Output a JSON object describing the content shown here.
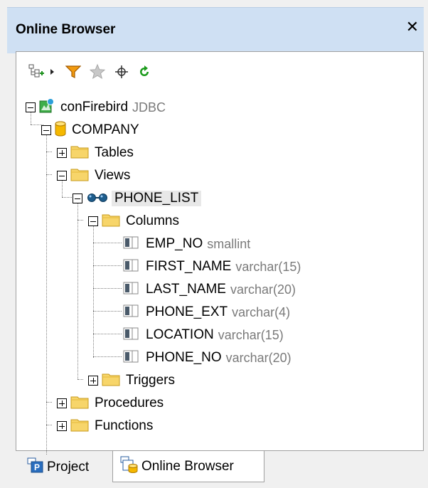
{
  "window": {
    "title": "Online Browser"
  },
  "toolbar": {
    "buttons": [
      {
        "icon": "add-connection-icon"
      },
      {
        "icon": "dropdown-arrow-icon"
      },
      {
        "icon": "filter-icon"
      },
      {
        "icon": "favorites-star-icon"
      },
      {
        "icon": "locate-crosshair-icon"
      },
      {
        "icon": "refresh-icon"
      }
    ]
  },
  "tree": {
    "connection": {
      "label": "conFirebird",
      "type": "JDBC"
    },
    "database": {
      "label": "COMPANY"
    },
    "tables": {
      "label": "Tables"
    },
    "views": {
      "label": "Views"
    },
    "view": {
      "label": "PHONE_LIST"
    },
    "columns_folder": {
      "label": "Columns"
    },
    "columns": [
      {
        "name": "EMP_NO",
        "type": "smallint"
      },
      {
        "name": "FIRST_NAME",
        "type": "varchar(15)"
      },
      {
        "name": "LAST_NAME",
        "type": "varchar(20)"
      },
      {
        "name": "PHONE_EXT",
        "type": "varchar(4)"
      },
      {
        "name": "LOCATION",
        "type": "varchar(15)"
      },
      {
        "name": "PHONE_NO",
        "type": "varchar(20)"
      }
    ],
    "triggers": {
      "label": "Triggers"
    },
    "procedures": {
      "label": "Procedures"
    },
    "functions": {
      "label": "Functions"
    }
  },
  "tabs": [
    {
      "label": "Project",
      "active": false
    },
    {
      "label": "Online Browser",
      "active": true
    }
  ],
  "colors": {
    "titlebar_bg": "#cfe0f3",
    "folder": "#f2c64a",
    "database": "#f5b800",
    "refresh": "#1a9a1a",
    "filter": "#e08a00"
  }
}
